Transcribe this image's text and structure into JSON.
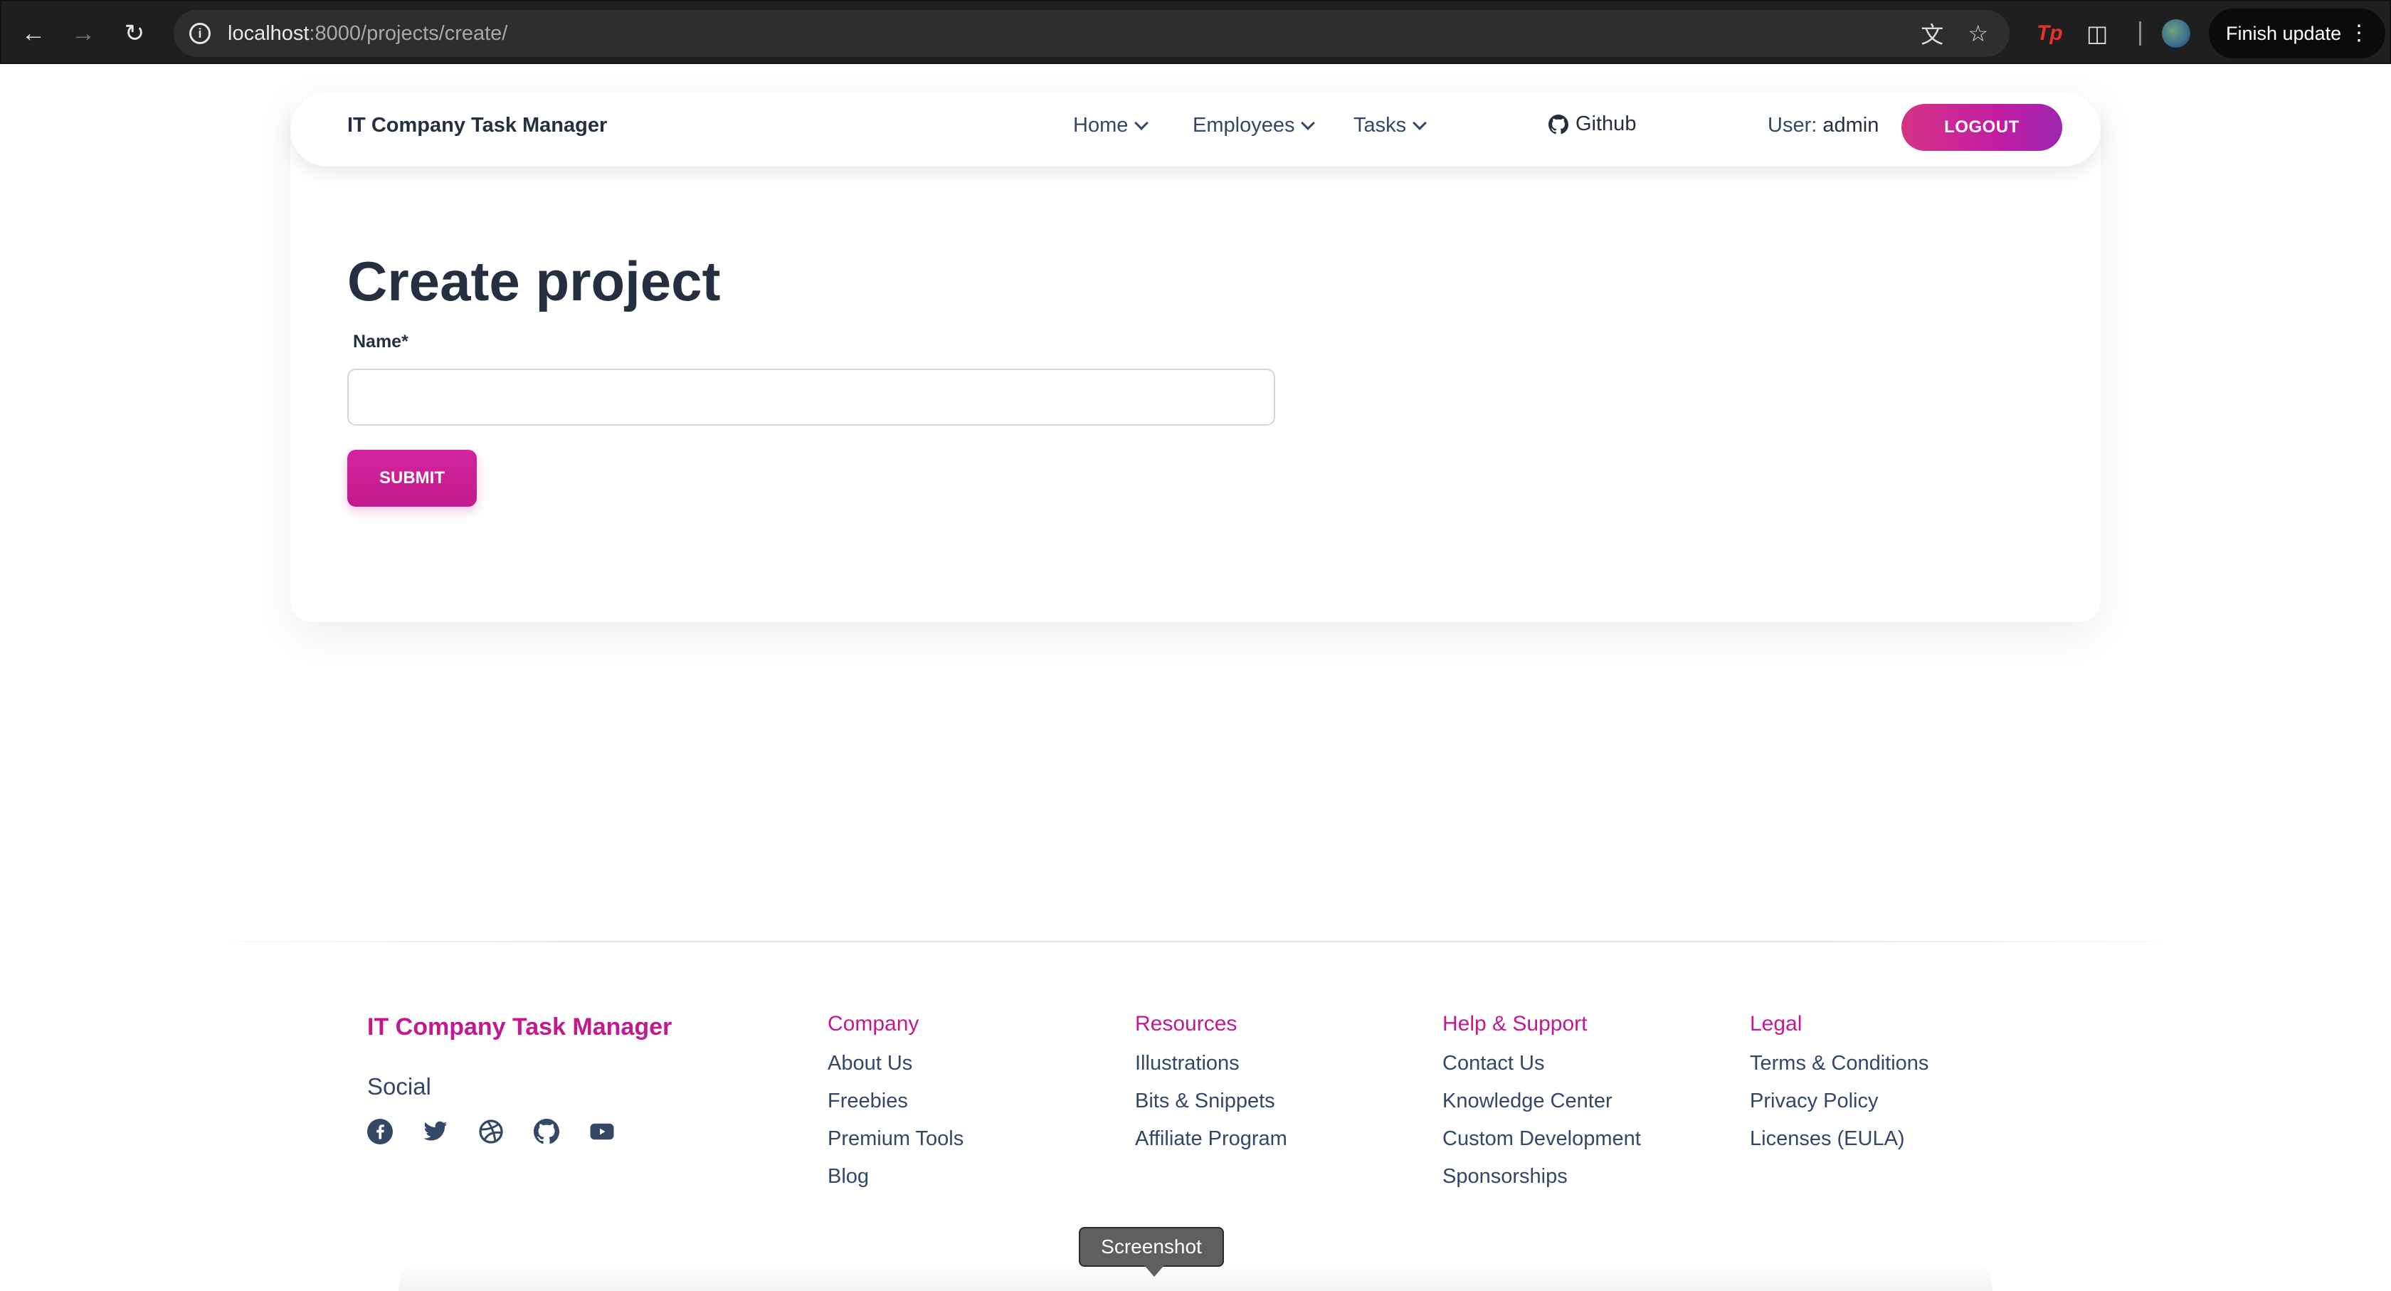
{
  "browser": {
    "url_host": "localhost",
    "url_path": ":8000/projects/create/",
    "update_label": "Finish update",
    "tp_label": "Tp"
  },
  "navbar": {
    "brand": "IT Company Task Manager",
    "links": [
      {
        "label": "Home"
      },
      {
        "label": "Employees"
      },
      {
        "label": "Tasks"
      }
    ],
    "github_label": "Github",
    "user_prefix": "User:",
    "user_name": "admin",
    "logout_label": "LOGOUT"
  },
  "form": {
    "title": "Create project",
    "name_label": "Name*",
    "name_value": "",
    "submit_label": "SUBMIT"
  },
  "footer": {
    "brand": "IT Company Task Manager",
    "social_title": "Social",
    "social_icons": [
      "facebook-icon",
      "twitter-icon",
      "dribbble-icon",
      "github-icon",
      "youtube-icon"
    ],
    "columns": [
      {
        "heading": "Company",
        "items": [
          "About Us",
          "Freebies",
          "Premium Tools",
          "Blog"
        ]
      },
      {
        "heading": "Resources",
        "items": [
          "Illustrations",
          "Bits & Snippets",
          "Affiliate Program"
        ]
      },
      {
        "heading": "Help & Support",
        "items": [
          "Contact Us",
          "Knowledge Center",
          "Custom Development",
          "Sponsorships"
        ]
      },
      {
        "heading": "Legal",
        "items": [
          "Terms & Conditions",
          "Privacy Policy",
          "Licenses (EULA)"
        ]
      }
    ]
  },
  "tooltip": {
    "label": "Screenshot"
  },
  "colors": {
    "accent": "#c21a8e",
    "heading": "#252f40",
    "text": "#344767"
  }
}
